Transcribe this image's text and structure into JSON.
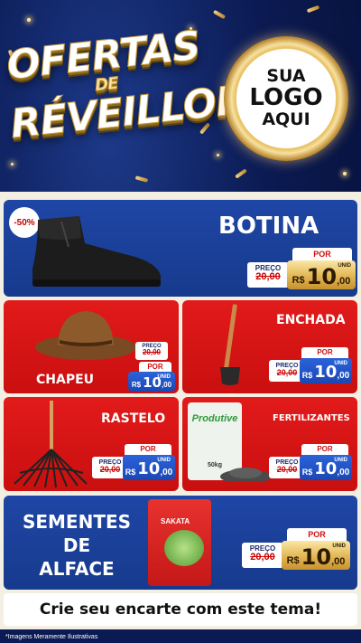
{
  "header": {
    "title_line1": "OFERTAS",
    "title_line2": "DE",
    "title_line3": "RÉVEILLON",
    "logo_line1": "SUA",
    "logo_line2": "LOGO",
    "logo_line3": "AQUI"
  },
  "products": [
    {
      "name": "BOTINA",
      "discount_badge": "-50%",
      "por_label": "POR",
      "preco_label": "PREÇO",
      "old_price": "20,00",
      "currency": "R$",
      "price_int": "10",
      "price_dec": ",00",
      "unit": "UNID"
    },
    {
      "name": "CHAPEU",
      "por_label": "POR",
      "preco_label": "PREÇO",
      "old_price": "20,00",
      "currency": "R$",
      "price_int": "10",
      "price_dec": ",00",
      "unit": "UNID"
    },
    {
      "name": "ENCHADA",
      "por_label": "POR",
      "preco_label": "PREÇO",
      "old_price": "20,00",
      "currency": "R$",
      "price_int": "10",
      "price_dec": ",00",
      "unit": "UNID"
    },
    {
      "name": "RASTELO",
      "por_label": "POR",
      "preco_label": "PREÇO",
      "old_price": "20,00",
      "currency": "R$",
      "price_int": "10",
      "price_dec": ",00",
      "unit": "UNID"
    },
    {
      "name": "FERTILIZANTES",
      "package_brand": "Produtive",
      "package_weight": "50kg",
      "por_label": "POR",
      "preco_label": "PREÇO",
      "old_price": "20,00",
      "currency": "R$",
      "price_int": "10",
      "price_dec": ",00",
      "unit": "UNID"
    },
    {
      "name_line1": "SEMENTES",
      "name_line2": "DE",
      "name_line3": "ALFACE",
      "package_brand": "SAKATA",
      "por_label": "POR",
      "preco_label": "PREÇO",
      "old_price": "20,00",
      "currency": "R$",
      "price_int": "10",
      "price_dec": ",00",
      "unit": "UNID"
    }
  ],
  "cta": "Crie seu encarte com este tema!",
  "footnote": "*Imagens Meramente Ilustrativas",
  "colors": {
    "blue": "#1f46a6",
    "red": "#e21a1a",
    "gold": "#e2b653",
    "navy": "#0b1a52"
  }
}
